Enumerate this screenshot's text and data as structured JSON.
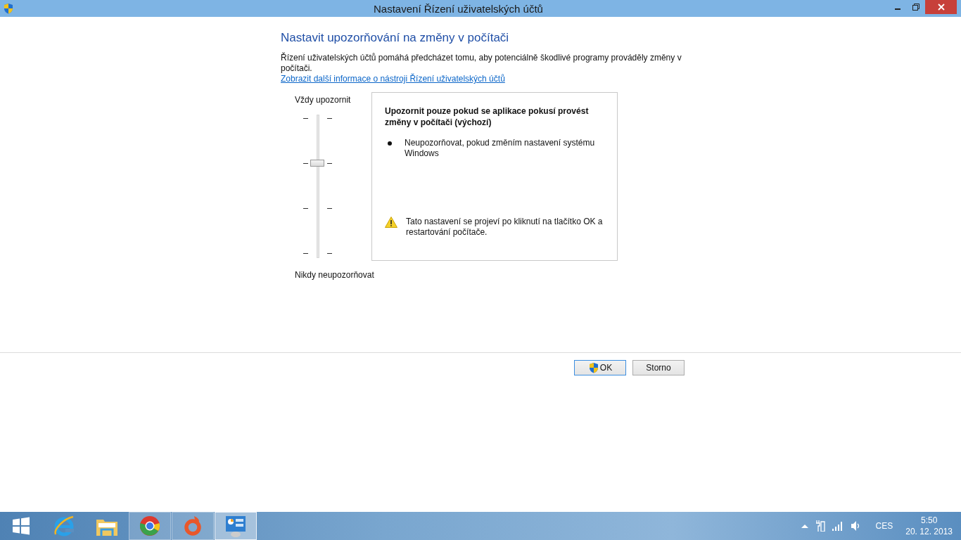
{
  "window": {
    "title": "Nastavení Řízení uživatelských účtů"
  },
  "heading": "Nastavit upozorňování na změny v počítači",
  "description": "Řízení uživatelských účtů pomáhá předcházet tomu, aby potenciálně škodlivé programy prováděly změny v počítači.",
  "info_link": "Zobrazit další informace o nástroji Řízení uživatelských účtů",
  "slider": {
    "top_label": "Vždy upozornit",
    "bottom_label": "Nikdy neupozorňovat",
    "level": 0.6667
  },
  "info_box": {
    "title": "Upozornit pouze pokud se aplikace pokusí provést změny v počítači (výchozí)",
    "bullets": [
      "Neupozorňovat, pokud změním nastavení systému Windows"
    ],
    "warning": "Tato nastavení se projeví po kliknutí na tlačítko OK a restartování počítače."
  },
  "buttons": [
    {
      "kind": "shield",
      "label": "OK",
      "selected": true
    },
    {
      "kind": "plain",
      "label": "Storno",
      "selected": false
    }
  ],
  "taskbar": {
    "items": [
      {
        "kind": "start",
        "running": false,
        "selected": false
      },
      {
        "kind": "browser-e",
        "running": false,
        "selected": false
      },
      {
        "kind": "folder",
        "running": false,
        "selected": false
      },
      {
        "kind": "chrome",
        "running": true,
        "selected": false
      },
      {
        "kind": "origin",
        "running": true,
        "selected": false
      },
      {
        "kind": "panel",
        "running": true,
        "selected": true
      }
    ],
    "language": "CES",
    "time": "5:50",
    "date": "20. 12. 2013"
  }
}
